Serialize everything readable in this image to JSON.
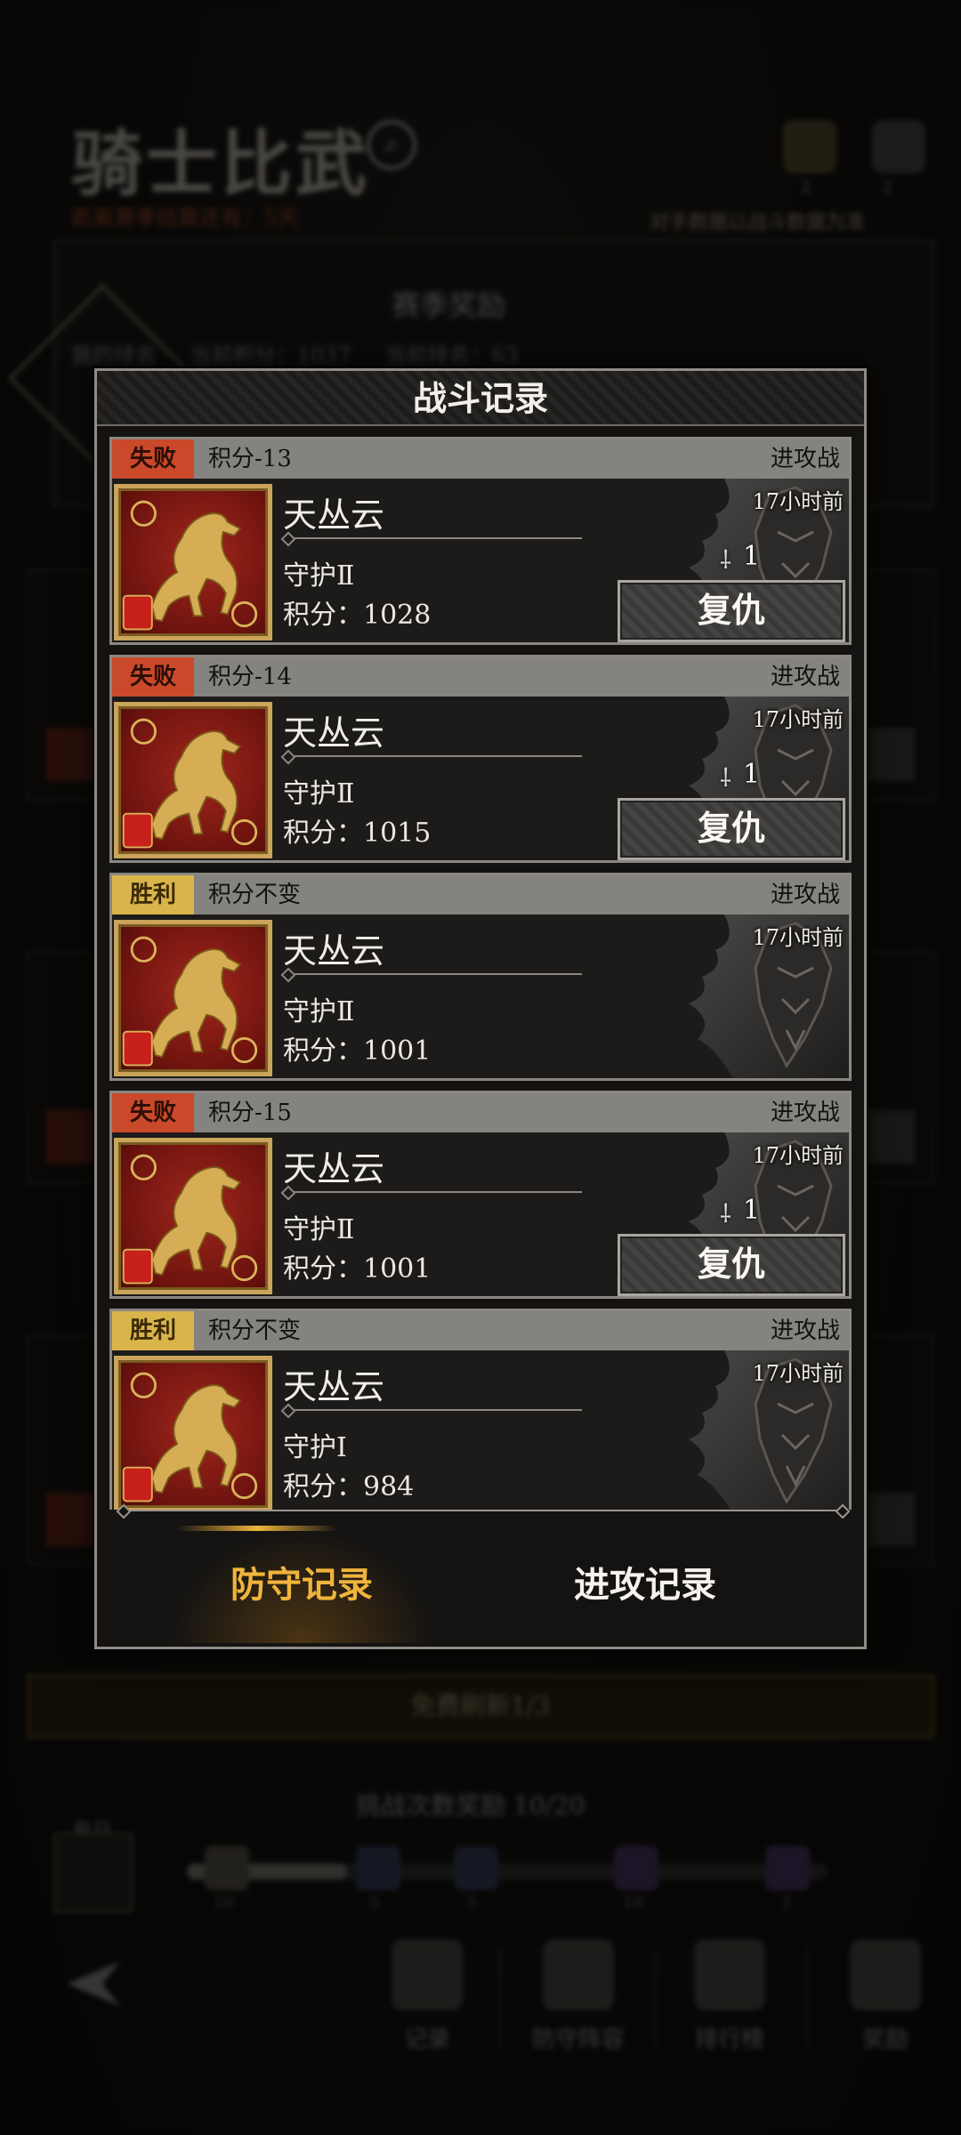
{
  "background": {
    "title": "骑士比武",
    "season_countdown": "距离赛季结算还有：5天",
    "notice": "对手数据以战斗数据为准",
    "icon_counts": [
      "2",
      "2"
    ],
    "season_reward_title": "赛季奖励",
    "season_stats": [
      "我的排名",
      "当前积分：1037",
      "当前排名：63"
    ],
    "refresh_button": "免费刷新1/3",
    "challenge_reward": "挑战次数奖励  10/20",
    "daily_label": "每日",
    "progress": {
      "fraction": 0.25,
      "nodes": [
        "10",
        "5",
        "5",
        "10",
        "2"
      ]
    },
    "nav": [
      {
        "label": "记录",
        "icon": "scroll-icon"
      },
      {
        "label": "防守阵容",
        "icon": "helmet-icon"
      },
      {
        "label": "排行榜",
        "icon": "trophy-icon"
      },
      {
        "label": "奖励",
        "icon": "chest-icon"
      }
    ]
  },
  "modal": {
    "title": "战斗记录",
    "records": [
      {
        "result": "失败",
        "result_type": "lose",
        "score_change": "积分-13",
        "battle_type": "进攻战",
        "name": "天丛云",
        "rank": "守护Ⅱ",
        "points": "积分：1028",
        "time": "17小时前",
        "count": "1",
        "revenge": "复仇"
      },
      {
        "result": "失败",
        "result_type": "lose",
        "score_change": "积分-14",
        "battle_type": "进攻战",
        "name": "天丛云",
        "rank": "守护Ⅱ",
        "points": "积分：1015",
        "time": "17小时前",
        "count": "1",
        "revenge": "复仇"
      },
      {
        "result": "胜利",
        "result_type": "win",
        "score_change": "积分不变",
        "battle_type": "进攻战",
        "name": "天丛云",
        "rank": "守护Ⅱ",
        "points": "积分：1001",
        "time": "17小时前",
        "count": "",
        "revenge": ""
      },
      {
        "result": "失败",
        "result_type": "lose",
        "score_change": "积分-15",
        "battle_type": "进攻战",
        "name": "天丛云",
        "rank": "守护Ⅱ",
        "points": "积分：1001",
        "time": "17小时前",
        "count": "1",
        "revenge": "复仇"
      },
      {
        "result": "胜利",
        "result_type": "win",
        "score_change": "积分不变",
        "battle_type": "进攻战",
        "name": "天丛云",
        "rank": "守护Ⅰ",
        "points": "积分：984",
        "time": "17小时前",
        "count": "",
        "revenge": ""
      }
    ],
    "tabs": {
      "defense": "防守记录",
      "attack": "进攻记录",
      "active": "defense"
    }
  },
  "colors": {
    "lose": "#c9492a",
    "win": "#d9b44a",
    "tab_active": "#f0b43c"
  }
}
